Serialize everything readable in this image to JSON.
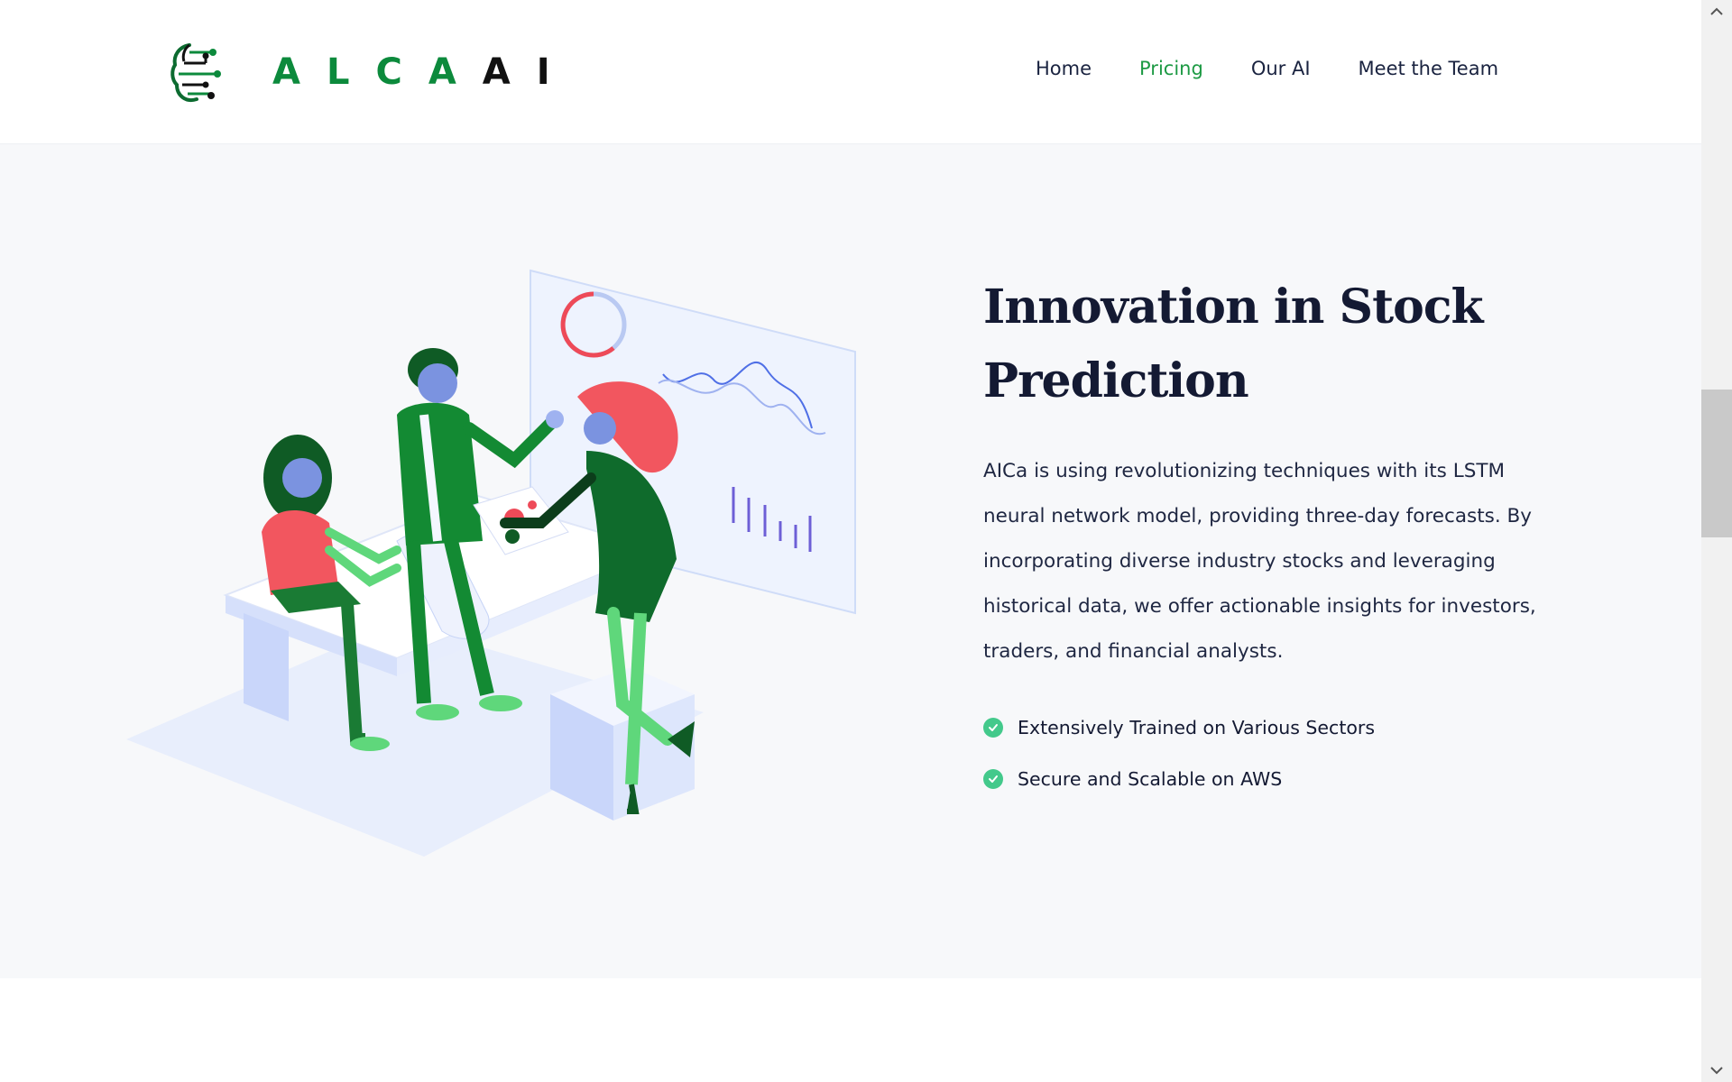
{
  "page": {
    "progress": 0.165,
    "colors": {
      "accent_green": "#1d9a44",
      "brand_green": "#0c8a3c",
      "progress_red": "#e8323f",
      "check_green": "#43c98b"
    }
  },
  "header": {
    "logo": {
      "icon": "circuit-brain-icon",
      "letters": [
        "A",
        "L",
        "C",
        "A",
        "A",
        "I"
      ]
    },
    "nav": [
      {
        "label": "Home",
        "active": false
      },
      {
        "label": "Pricing",
        "active": true
      },
      {
        "label": "Our AI",
        "active": false
      },
      {
        "label": "Meet the Team",
        "active": false
      }
    ]
  },
  "hero": {
    "title_line1": "Innovation in Stock",
    "title_line2": "Prediction",
    "description": "AICa is using revolutionizing techniques with its LSTM neural network model, providing three-day forecasts. By incorporating diverse industry stocks and leveraging historical data, we offer actionable insights for investors, traders, and financial analysts.",
    "features": [
      {
        "icon": "check-circle-icon",
        "label": "Extensively Trained on Various Sectors"
      },
      {
        "icon": "check-circle-icon",
        "label": "Secure and Scalable on AWS"
      }
    ],
    "illustration": "team-analyzing-charts-illustration"
  },
  "scrollbar": {
    "position": 0.36
  }
}
